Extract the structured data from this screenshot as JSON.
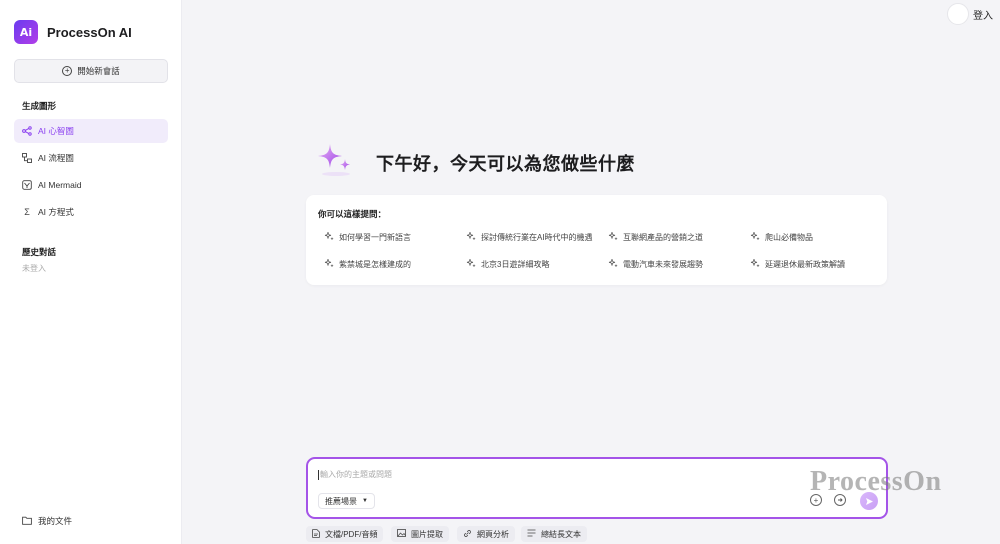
{
  "brand": {
    "name": "ProcessOn AI",
    "logo_text": "Ai",
    "accent": "#8a3ff0"
  },
  "sidebar": {
    "new_chat_label": "開始新會話",
    "section_generate": "生成圖形",
    "items": [
      {
        "label": "AI 心智圖",
        "icon": "mindmap-icon",
        "active": true
      },
      {
        "label": "AI 流程圖",
        "icon": "flowchart-icon",
        "active": false
      },
      {
        "label": "AI Mermaid",
        "icon": "mermaid-icon",
        "active": false
      },
      {
        "label": "AI 方程式",
        "icon": "formula-icon",
        "active": false
      }
    ],
    "section_history": "歷史對話",
    "history_empty": "未登入",
    "my_files": "我的文件"
  },
  "header": {
    "login_label": "登入"
  },
  "main": {
    "greeting": "下午好，今天可以為您做些什麼",
    "suggest_title": "你可以這樣提問：",
    "suggestions": [
      "如何學習一門新語言",
      "探討傳統行業在AI時代中的機遇",
      "互聯網產品的營銷之道",
      "爬山必備物品",
      "紫禁城是怎樣建成的",
      "北京3日遊詳細攻略",
      "電動汽車未來發展趨勢",
      "延遲退休最新政策解讀"
    ]
  },
  "input": {
    "placeholder": "輸入你的主題或問題",
    "scene_label": "推薦場景",
    "watermark": "ProcessOn"
  },
  "tools": [
    {
      "label": "文檔/PDF/音頻",
      "icon": "document-icon"
    },
    {
      "label": "圖片提取",
      "icon": "image-icon"
    },
    {
      "label": "網頁分析",
      "icon": "link-icon"
    },
    {
      "label": "總結長文本",
      "icon": "text-icon"
    }
  ]
}
